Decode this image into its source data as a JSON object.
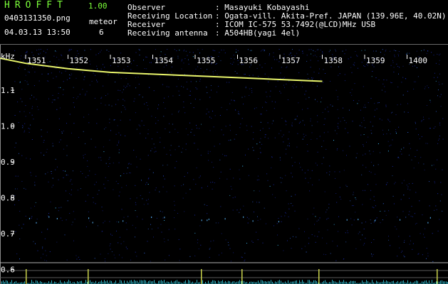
{
  "app": {
    "title": "HROFFT",
    "version": "1.00"
  },
  "file": {
    "name": "0403131350.png",
    "datetime": "04.03.13 13:50"
  },
  "meteor": {
    "label": "meteor",
    "count": "6"
  },
  "info": [
    {
      "key": "Observer",
      "value": ": Masayuki Kobayashi"
    },
    {
      "key": "Receiving Location",
      "value": ": Ogata-vill. Akita-Pref. JAPAN (139.96E, 40.02N)"
    },
    {
      "key": "Receiver",
      "value": ": ICOM IC-575 53.7492(@LCD)MHz USB"
    },
    {
      "key": "Receiving antenna",
      "value": ": A504HB(yagi 4el)"
    }
  ],
  "chart_data": {
    "type": "spectrogram",
    "xlabel": "",
    "ylabel": "kHz",
    "x_ticks": [
      "1351",
      "1352",
      "1353",
      "1354",
      "1355",
      "1356",
      "1357",
      "1358",
      "1359",
      "1400"
    ],
    "y_ticks": [
      "1.1",
      "1.0",
      "0.9",
      "0.8",
      "0.7",
      "0.6"
    ],
    "ylim": [
      0.57,
      1.2
    ],
    "trace": {
      "name": "",
      "x": [
        "13:50:00",
        "13:51:00",
        "13:52:00",
        "13:53:00",
        "13:54:00",
        "13:55:00",
        "13:56:00",
        "13:57:00",
        "13:58:00"
      ],
      "y": [
        1.19,
        1.175,
        1.16,
        1.15,
        1.145,
        1.14,
        1.135,
        1.13,
        1.125
      ]
    },
    "colors": {
      "background": "#000000",
      "noise": "#1a2aa8",
      "trace": "#e9f56b",
      "grid": "#8a8a8a"
    }
  }
}
